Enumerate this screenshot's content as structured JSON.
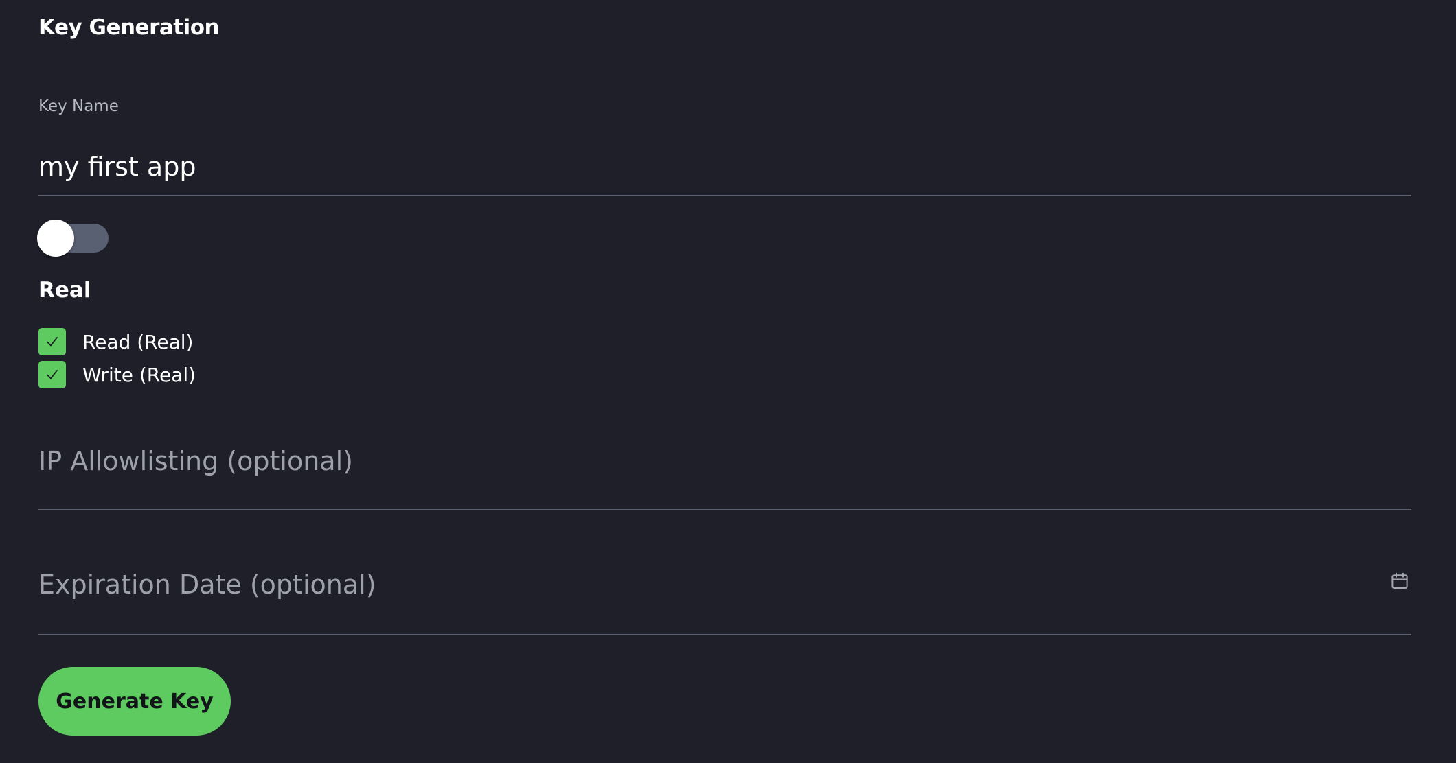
{
  "header": {
    "title": "Key Generation"
  },
  "key_name": {
    "label": "Key Name",
    "value": "my first app"
  },
  "environment_toggle": {
    "state": "off",
    "icon": "toggle-switch"
  },
  "permissions": {
    "heading": "Real",
    "items": [
      {
        "label": "Read (Real)",
        "checked": true,
        "icon": "checkmark-icon"
      },
      {
        "label": "Write (Real)",
        "checked": true,
        "icon": "checkmark-icon"
      }
    ]
  },
  "ip_allowlisting": {
    "placeholder": "IP Allowlisting (optional)",
    "value": ""
  },
  "expiration_date": {
    "placeholder": "Expiration Date (optional)",
    "value": "",
    "icon": "calendar-icon"
  },
  "actions": {
    "generate_label": "Generate Key"
  },
  "colors": {
    "background": "#1e1f29",
    "accent": "#5dcb5f",
    "divider": "#5d606e",
    "toggle_track": "#596072"
  }
}
